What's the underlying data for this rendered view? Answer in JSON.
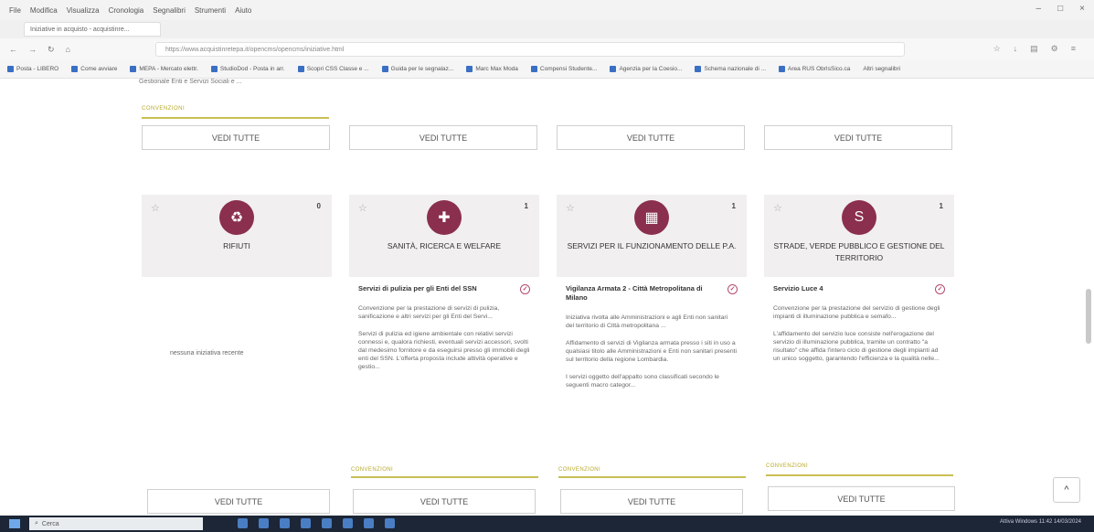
{
  "browser": {
    "menu": [
      "File",
      "Modifica",
      "Visualizza",
      "Cronologia",
      "Segnalibri",
      "Strumenti",
      "Aiuto"
    ],
    "tab_title": "Iniziative in acquisto - acquistinre...",
    "url": "https://www.acquistinretepa.it/opencms/opencms/iniziative.html",
    "bookmarks": [
      "Posta - LIBERO",
      "Come avviare",
      "MEPA - Mercato elettr.",
      "StudioDod - Posta in arr.",
      "Scopri CSS Classe e ...",
      "Guida per le segnalaz...",
      "Marc Max Moda",
      "Compensi Studente...",
      "Agenzia per la Coesio...",
      "Schema nazionale di ...",
      "Area RUS ObrIsSico.ca"
    ],
    "bookmark_other": "Altri segnalibri"
  },
  "page": {
    "top_cut_text": "Gestionale Enti e Servizi Sociali e ...",
    "top_badge": "CONVENZIONI",
    "vedi_tutte": "VEDI TUTTE",
    "scroll_top_icon": "^"
  },
  "cards": [
    {
      "title": "RIFIUTI",
      "count": "0",
      "icon": "bin-icon",
      "empty_text": "nessuna iniziativa recente"
    },
    {
      "title": "SANITÀ, RICERCA E WELFARE",
      "count": "1",
      "icon": "health-icon",
      "item_title": "Servizi di pulizia per gli Enti del SSN",
      "desc1": "Convenzione per la prestazione di servizi di pulizia, sanificazione e altri servizi per gli Enti del Servi...",
      "desc2": "Servizi di pulizia ed igiene ambientale con relativi servizi connessi e, qualora richiesti, eventuali servizi accessori, svolti dal medesimo fornitore e da eseguirsi presso gli immobili degli enti del SSN. L'offerta proposta include attività operative e gestio...",
      "badge": "CONVENZIONI"
    },
    {
      "title": "SERVIZI PER IL FUNZIONAMENTO DELLE P.A.",
      "count": "1",
      "icon": "office-icon",
      "item_title": "Vigilanza Armata 2 - Città Metropolitana di Milano",
      "desc1": "Iniziativa rivolta alle Amministrazioni e agli Enti non sanitari del territorio di Città metropolitana ...",
      "desc2": "Affidamento di servizi di Vigilanza armata presso i siti in uso a qualsiasi titolo alle Amministrazioni e Enti non sanitari presenti sul territorio della regione Lombardia.",
      "desc3": "I servizi oggetto dell'appalto sono classificati secondo le seguenti macro categor...",
      "badge": "CONVENZIONI"
    },
    {
      "title": "STRADE, VERDE PUBBLICO E GESTIONE DEL TERRITORIO",
      "count": "1",
      "icon": "road-icon",
      "item_title": "Servizio Luce 4",
      "desc1": "Convenzione per la prestazione del servizio di gestione degli impianti di illuminazione pubblica e semafo...",
      "desc2": "L'affidamento del servizio luce consiste nell'erogazione del servizio di illuminazione pubblica, tramite un contratto \"a risultato\" che affida l'intero ciclo di gestione degli impianti ad un unico soggetto, garantendo l'efficienza e la qualità nelle...",
      "badge": "CONVENZIONI"
    }
  ],
  "taskbar": {
    "search": "Cerca",
    "tray": "Attiva Windows  11:42  14/03/2024"
  },
  "colors": {
    "accent": "#8b2f4e",
    "badge": "#b8a92a",
    "card_bg": "#f1eff0"
  }
}
